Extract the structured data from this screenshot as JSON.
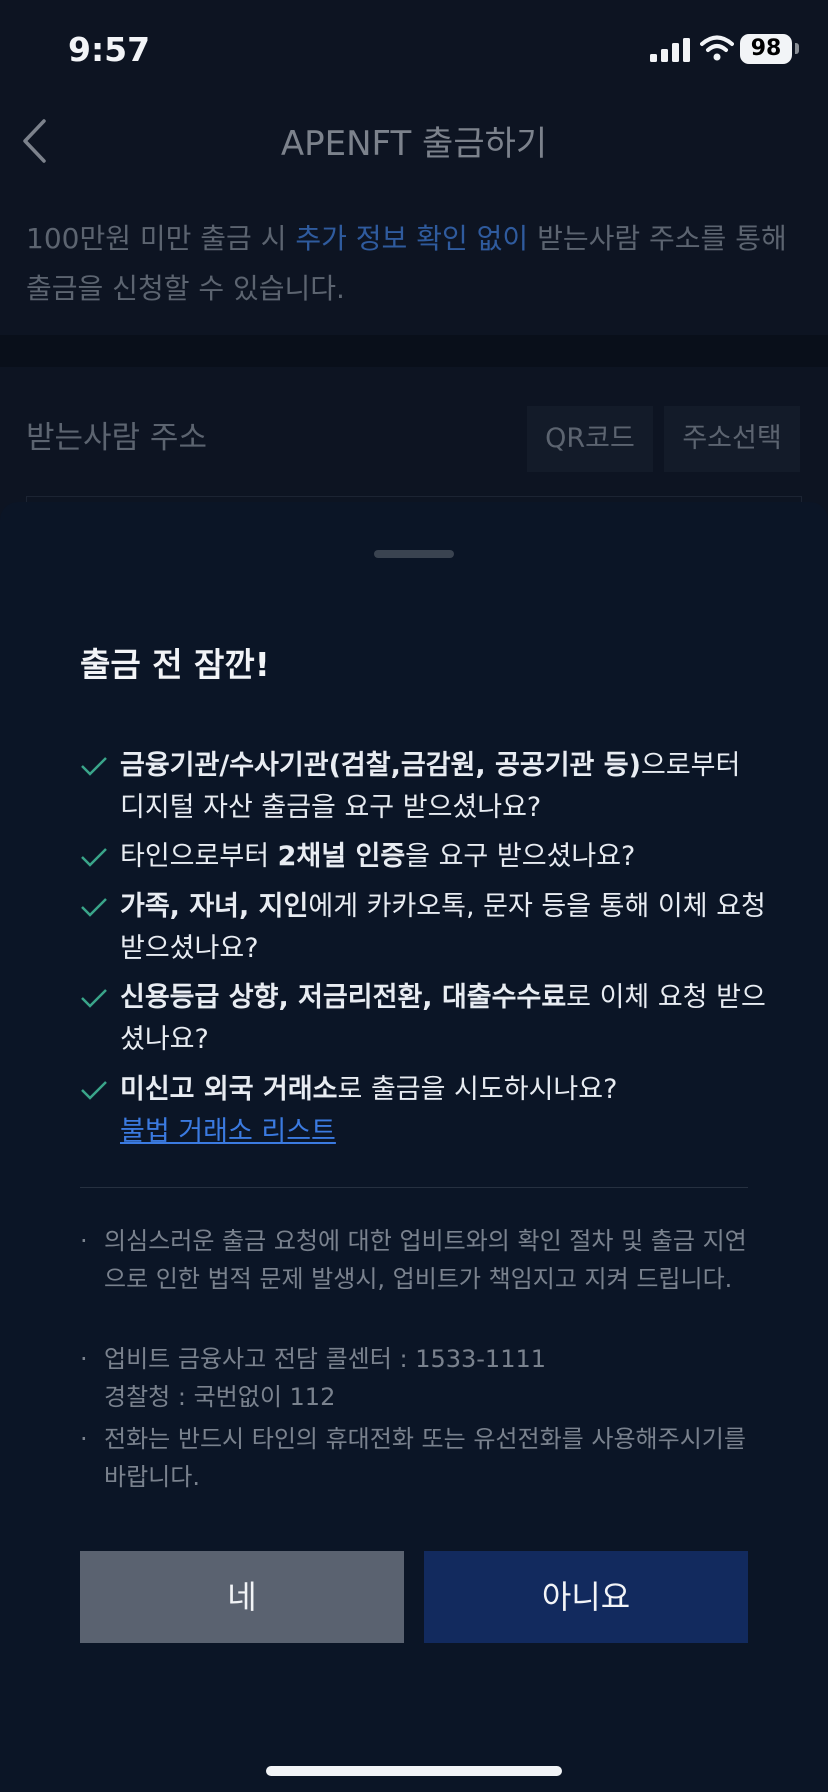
{
  "status_bar": {
    "time": "9:57",
    "battery": "98"
  },
  "header": {
    "title": "APENFT 출금하기"
  },
  "notice": {
    "part1": "100만원 미만 출금 시 ",
    "highlight": "추가 정보 확인 없이",
    "part2": " 받는사람 주소를 통해 출금을 신청할 수 있습니다."
  },
  "address": {
    "label": "받는사람 주소",
    "qr_button": "QR코드",
    "select_button": "주소선택"
  },
  "sheet": {
    "title": "출금 전 잠깐!",
    "items": [
      {
        "bold": "금융기관/수사기관(검찰,금감원, 공공기관 등)",
        "rest": "으로부터 디지털 자산 출금을 요구 받으셨나요?"
      },
      {
        "pre": "타인으로부터 ",
        "bold": "2채널 인증",
        "rest": "을 요구 받으셨나요?"
      },
      {
        "bold": "가족, 자녀, 지인",
        "rest": "에게 카카오톡, 문자 등을 통해 이체 요청 받으셨나요?"
      },
      {
        "bold": "신용등급 상향, 저금리전환, 대출수수료",
        "rest": "로 이체 요청 받으셨나요?"
      },
      {
        "bold": "미신고 외국 거래소",
        "rest": "로 출금을 시도하시나요?",
        "link": "불법 거래소 리스트"
      }
    ],
    "notes": [
      "의심스러운 출금 요청에 대한 업비트와의 확인 절차 및 출금 지연으로 인한 법적 문제 발생시, 업비트가 책임지고 지켜 드립니다.",
      "업비트 금융사고 전담 콜센터 : 1533-1111",
      "경찰청 : 국번없이 112",
      "전화는 반드시 타인의 휴대전화 또는 유선전화를 사용해주시기를 바랍니다."
    ],
    "bullet": "·",
    "yes_button": "네",
    "no_button": "아니요"
  }
}
